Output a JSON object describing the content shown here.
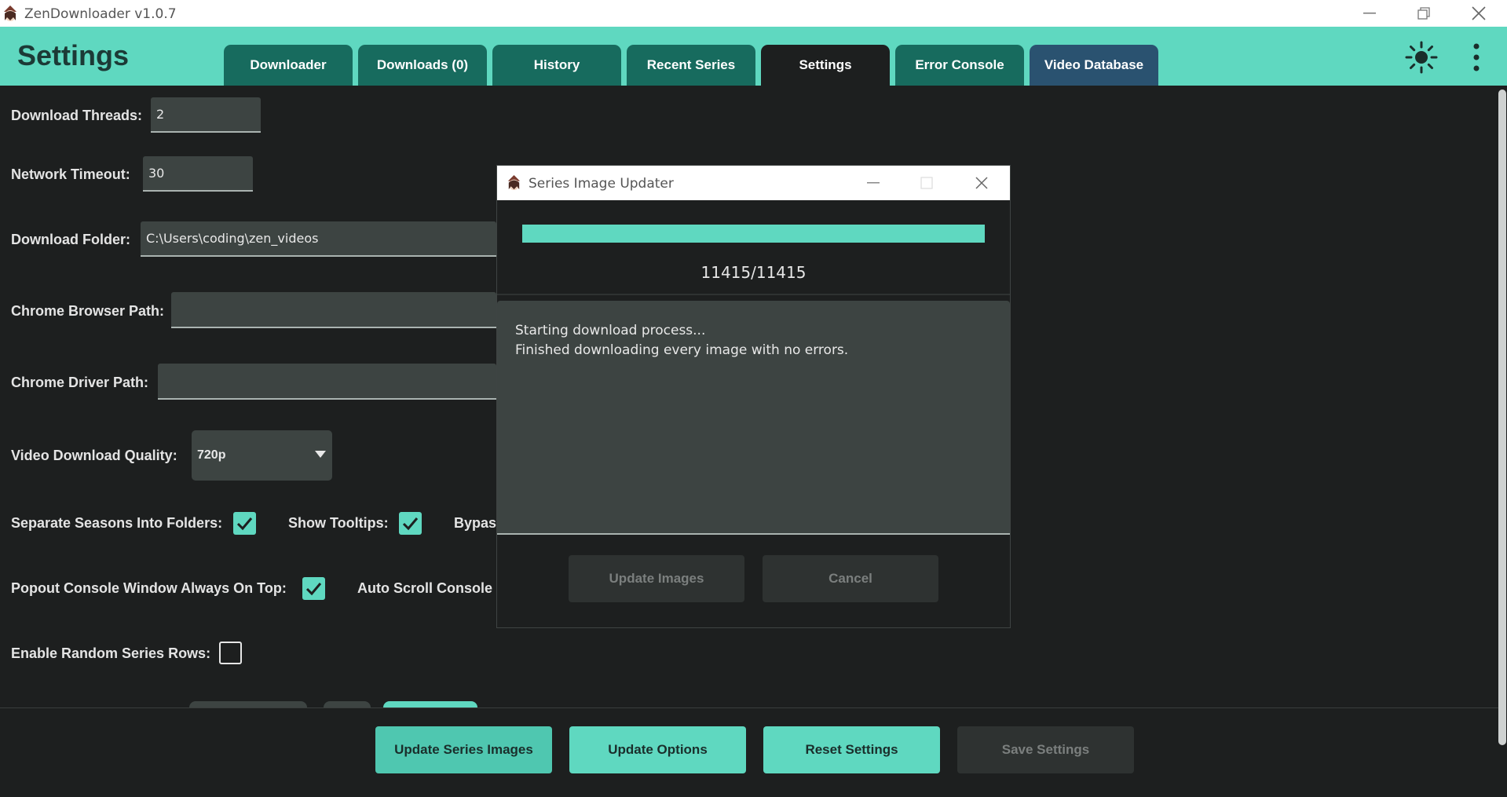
{
  "window": {
    "title": "ZenDownloader v1.0.7"
  },
  "header": {
    "page_title": "Settings",
    "tabs": [
      {
        "label": "Downloader",
        "active": false
      },
      {
        "label": "Downloads (0)",
        "active": false
      },
      {
        "label": "History",
        "active": false
      },
      {
        "label": "Recent Series",
        "active": false
      },
      {
        "label": "Settings",
        "active": true
      },
      {
        "label": "Error Console",
        "active": false
      },
      {
        "label": "Video Database",
        "active": false
      }
    ],
    "icons": [
      "theme-toggle-sun-icon",
      "more-options-kebab-icon"
    ]
  },
  "settings": {
    "download_threads": {
      "label": "Download Threads:",
      "value": "2"
    },
    "network_timeout": {
      "label": "Network Timeout:",
      "value": "30"
    },
    "download_folder": {
      "label": "Download Folder:",
      "value": "C:\\Users\\coding\\zen_videos"
    },
    "chrome_browser_path": {
      "label": "Chrome Browser Path:",
      "value": ""
    },
    "chrome_driver_path": {
      "label": "Chrome Driver Path:",
      "value": ""
    },
    "video_quality": {
      "label": "Video Download Quality:",
      "value": "720p"
    },
    "separate_seasons": {
      "label": "Separate Seasons Into Folders:",
      "checked": true
    },
    "show_tooltips": {
      "label": "Show Tooltips:",
      "checked": true
    },
    "bypass_partial": {
      "label": "Bypass"
    },
    "popout_on_top": {
      "label": "Popout Console Window Always On Top:",
      "checked": true
    },
    "auto_scroll_partial": {
      "label": "Auto Scroll Console"
    },
    "random_series_rows": {
      "label": "Enable Random Series Rows:",
      "checked": false
    }
  },
  "footer": {
    "update_series_images": "Update Series Images",
    "update_options": "Update Options",
    "reset_settings": "Reset Settings",
    "save_settings": "Save Settings"
  },
  "dialog": {
    "title": "Series Image Updater",
    "progress_fraction": 1.0,
    "count_text": "11415/11415",
    "log_lines": [
      "Starting download process...",
      "Finished downloading every image with no errors."
    ],
    "update_images_label": "Update Images",
    "cancel_label": "Cancel"
  },
  "colors": {
    "accent": "#5fd8c0",
    "tab_bg": "#176b5e",
    "tab_db_bg": "#2a5270",
    "background": "#1d1f1f",
    "field_bg": "#3d4442"
  }
}
